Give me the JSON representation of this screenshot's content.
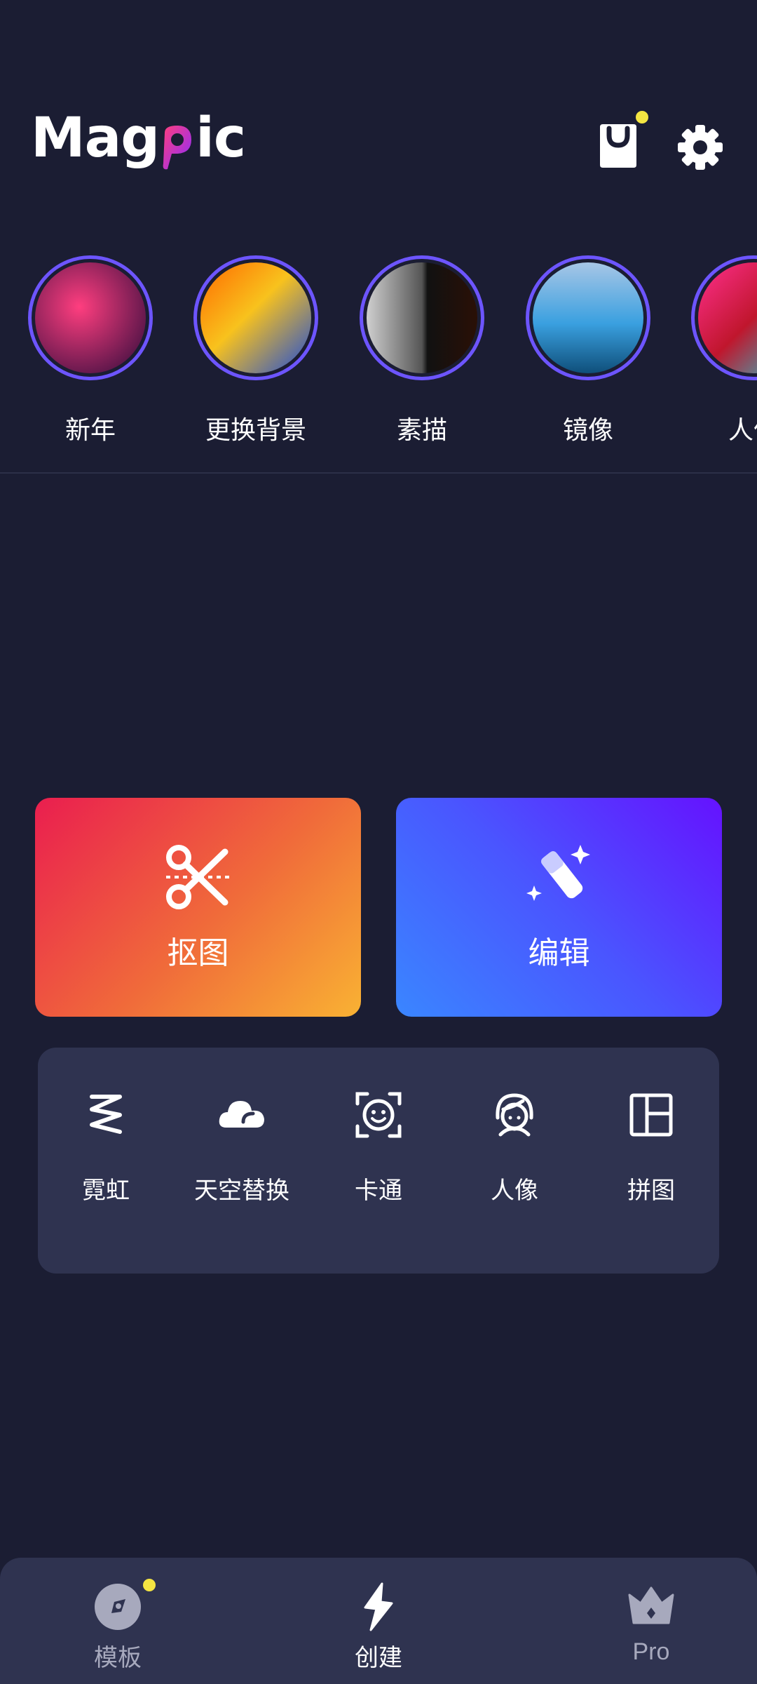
{
  "header": {
    "logo_text_left": "Mag",
    "logo_text_right": "ic",
    "cart_icon": "shopping-bag-icon",
    "settings_icon": "gear-icon",
    "cart_badge_color": "#f4e542"
  },
  "stories": [
    {
      "label": "新年",
      "gradient": [
        "#ff3e7f",
        "#2a0a3a"
      ]
    },
    {
      "label": "更换背景",
      "gradient": [
        "#f8c21d",
        "#1d4bd8"
      ]
    },
    {
      "label": "素描",
      "gradient": [
        "#cfcfcf",
        "#1a1a1a"
      ]
    },
    {
      "label": "镜像",
      "gradient": [
        "#3aa0e0",
        "#a7c6e6"
      ]
    },
    {
      "label": "人像",
      "gradient": [
        "#ff2f8e",
        "#1ad0d8"
      ]
    }
  ],
  "actions": {
    "cutout": {
      "label": "抠图",
      "icon": "scissors-icon"
    },
    "edit": {
      "label": "编辑",
      "icon": "magic-wand-icon"
    }
  },
  "tools": [
    {
      "label": "霓虹",
      "icon": "neon-zigzag-icon"
    },
    {
      "label": "天空替换",
      "icon": "cloud-icon"
    },
    {
      "label": "卡通",
      "icon": "cartoon-face-icon"
    },
    {
      "label": "人像",
      "icon": "portrait-icon"
    },
    {
      "label": "拼图",
      "icon": "collage-layout-icon"
    }
  ],
  "nav": {
    "templates": {
      "label": "模板",
      "icon": "template-disc-icon"
    },
    "create": {
      "label": "创建",
      "icon": "lightning-icon"
    },
    "pro": {
      "label": "Pro",
      "icon": "crown-icon"
    }
  },
  "colors": {
    "background": "#1b1d33",
    "panel": "#2f3350",
    "ring": "#6d55ff",
    "accent_yellow": "#f4e542"
  }
}
